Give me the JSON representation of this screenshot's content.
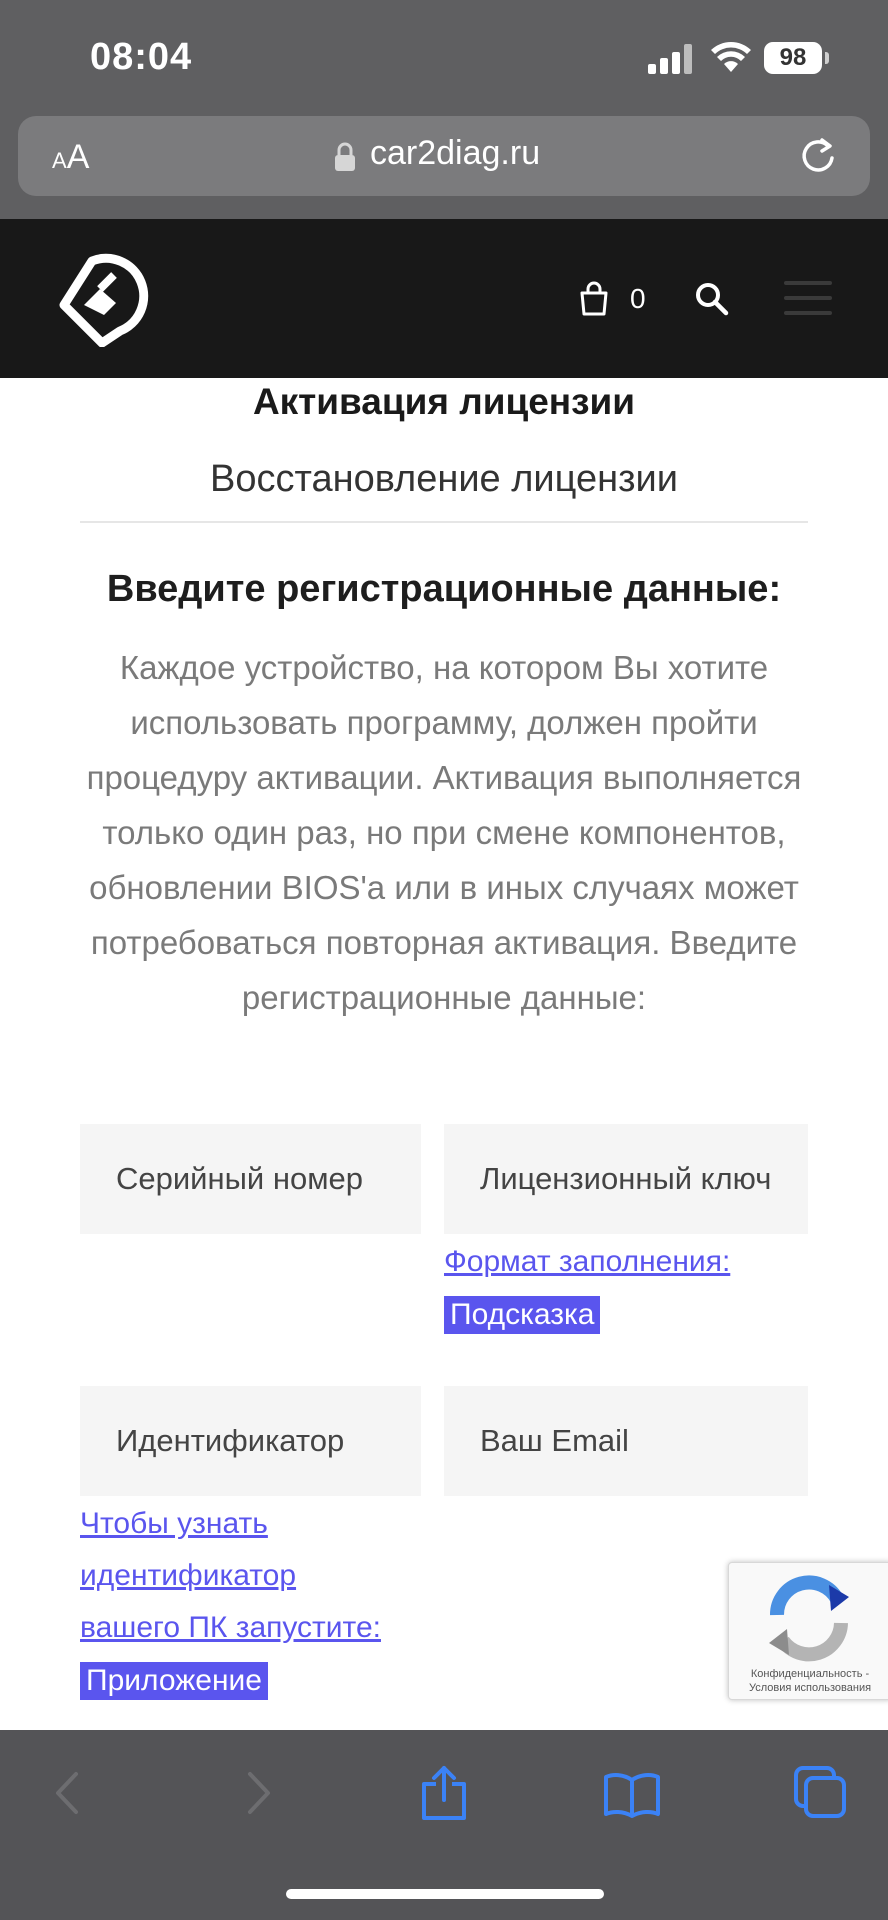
{
  "status_bar": {
    "time": "08:04",
    "battery": "98"
  },
  "browser": {
    "text_size_label": "AA",
    "url": "car2diag.ru"
  },
  "site_header": {
    "cart_count": "0"
  },
  "page": {
    "title": "Активация лицензии",
    "tab_label": "Восстановление лицензии",
    "subtitle": "Введите регистрационные данные:",
    "description": "Каждое устройство, на котором Вы хотите использовать программу, должен пройти процедуру активации. Активация выполняется только один раз, но при смене компонентов, обновлении BIOS'а или в иных случаях может потребоваться повторная активация. Введите регистрационные данные:"
  },
  "form": {
    "serial_placeholder": "Серийный номер",
    "license_key_placeholder": "Лицензионный ключ",
    "format_link": "Формат заполнения:",
    "hint_label": "Подсказка",
    "identifier_placeholder": "Идентификатор",
    "email_placeholder": "Ваш Email",
    "identifier_help_line1": "Чтобы узнать",
    "identifier_help_line2": "идентификатор",
    "identifier_help_line3": "вашего ПК запустите:",
    "app_label": "Приложение"
  },
  "recaptcha": {
    "privacy": "Конфиденциальность -",
    "terms": "Условия использования"
  },
  "colors": {
    "link": "#5a55ee",
    "header_bg": "#181818",
    "field_bg": "#f5f5f5"
  }
}
